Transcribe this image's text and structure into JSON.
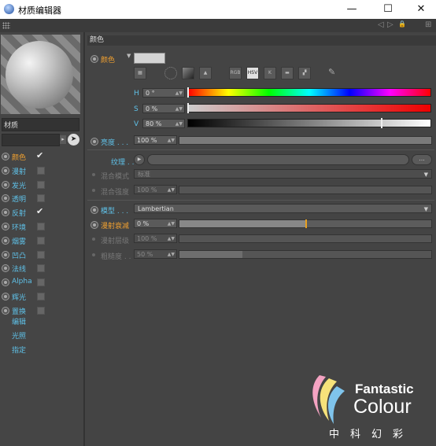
{
  "window": {
    "title": "材质编辑器",
    "buttons": {
      "minimize": "—",
      "maximize": "☐",
      "close": "✕"
    }
  },
  "toolbar": {
    "icons": [
      "arrow-left-icon",
      "arrow-right-icon",
      "lock-icon",
      "expand-icon"
    ],
    "glyphs": {
      "back": "◁",
      "forward": "▷",
      "lock": "🔒",
      "expand": "⊞"
    }
  },
  "material": {
    "name": "材质"
  },
  "channels": [
    {
      "label": "颜色",
      "checked": true,
      "active": true
    },
    {
      "label": "漫射",
      "checked": false
    },
    {
      "label": "发光",
      "checked": false
    },
    {
      "label": "透明",
      "checked": false
    },
    {
      "label": "反射",
      "checked": true
    },
    {
      "label": "环境",
      "checked": false
    },
    {
      "label": "烟雾",
      "checked": false
    },
    {
      "label": "凹凸",
      "checked": false
    },
    {
      "label": "法线",
      "checked": false
    },
    {
      "label": "Alpha",
      "checked": false
    },
    {
      "label": "辉光",
      "checked": false
    },
    {
      "label": "置换",
      "checked": false
    }
  ],
  "links": [
    "编辑",
    "光照",
    "指定"
  ],
  "check_glyph": "✔",
  "color_section": {
    "header": "颜色",
    "color_label": "颜色",
    "swatch_color": "#d4d4d4",
    "mode_buttons": [
      "RGB",
      "HSV",
      "K"
    ],
    "h": {
      "label": "H",
      "value": "0 °",
      "level": 0
    },
    "s": {
      "label": "S",
      "value": "0 %",
      "level": 0
    },
    "v": {
      "label": "V",
      "value": "80 %",
      "level": 0.8
    },
    "brightness": {
      "label": "亮度 . . .",
      "value": "100 %",
      "level": 1.0
    },
    "texture": {
      "label": "纹理 . . .",
      "button": "..."
    },
    "blend_mode": {
      "label": "混合模式",
      "value": "标准"
    },
    "blend_strength": {
      "label": "混合强度",
      "value": "100 %"
    },
    "model": {
      "label": "模型 . . .",
      "value": "Lambertian"
    },
    "diffuse_falloff": {
      "label": "漫射衰减",
      "value": "0 %",
      "level": 0.5
    },
    "diffuse_level": {
      "label": "漫射层级",
      "value": "100 %"
    },
    "roughness": {
      "label": "粗糙度 . .",
      "value": "50 %",
      "level": 0.25
    }
  },
  "watermark": {
    "line1": "Fantastic",
    "line2": "Colour",
    "chinese": "中科幻彩"
  },
  "colors": {
    "accent_orange": "#f0a030",
    "accent_blue": "#5fc1e8",
    "panel_bg": "#444444"
  }
}
